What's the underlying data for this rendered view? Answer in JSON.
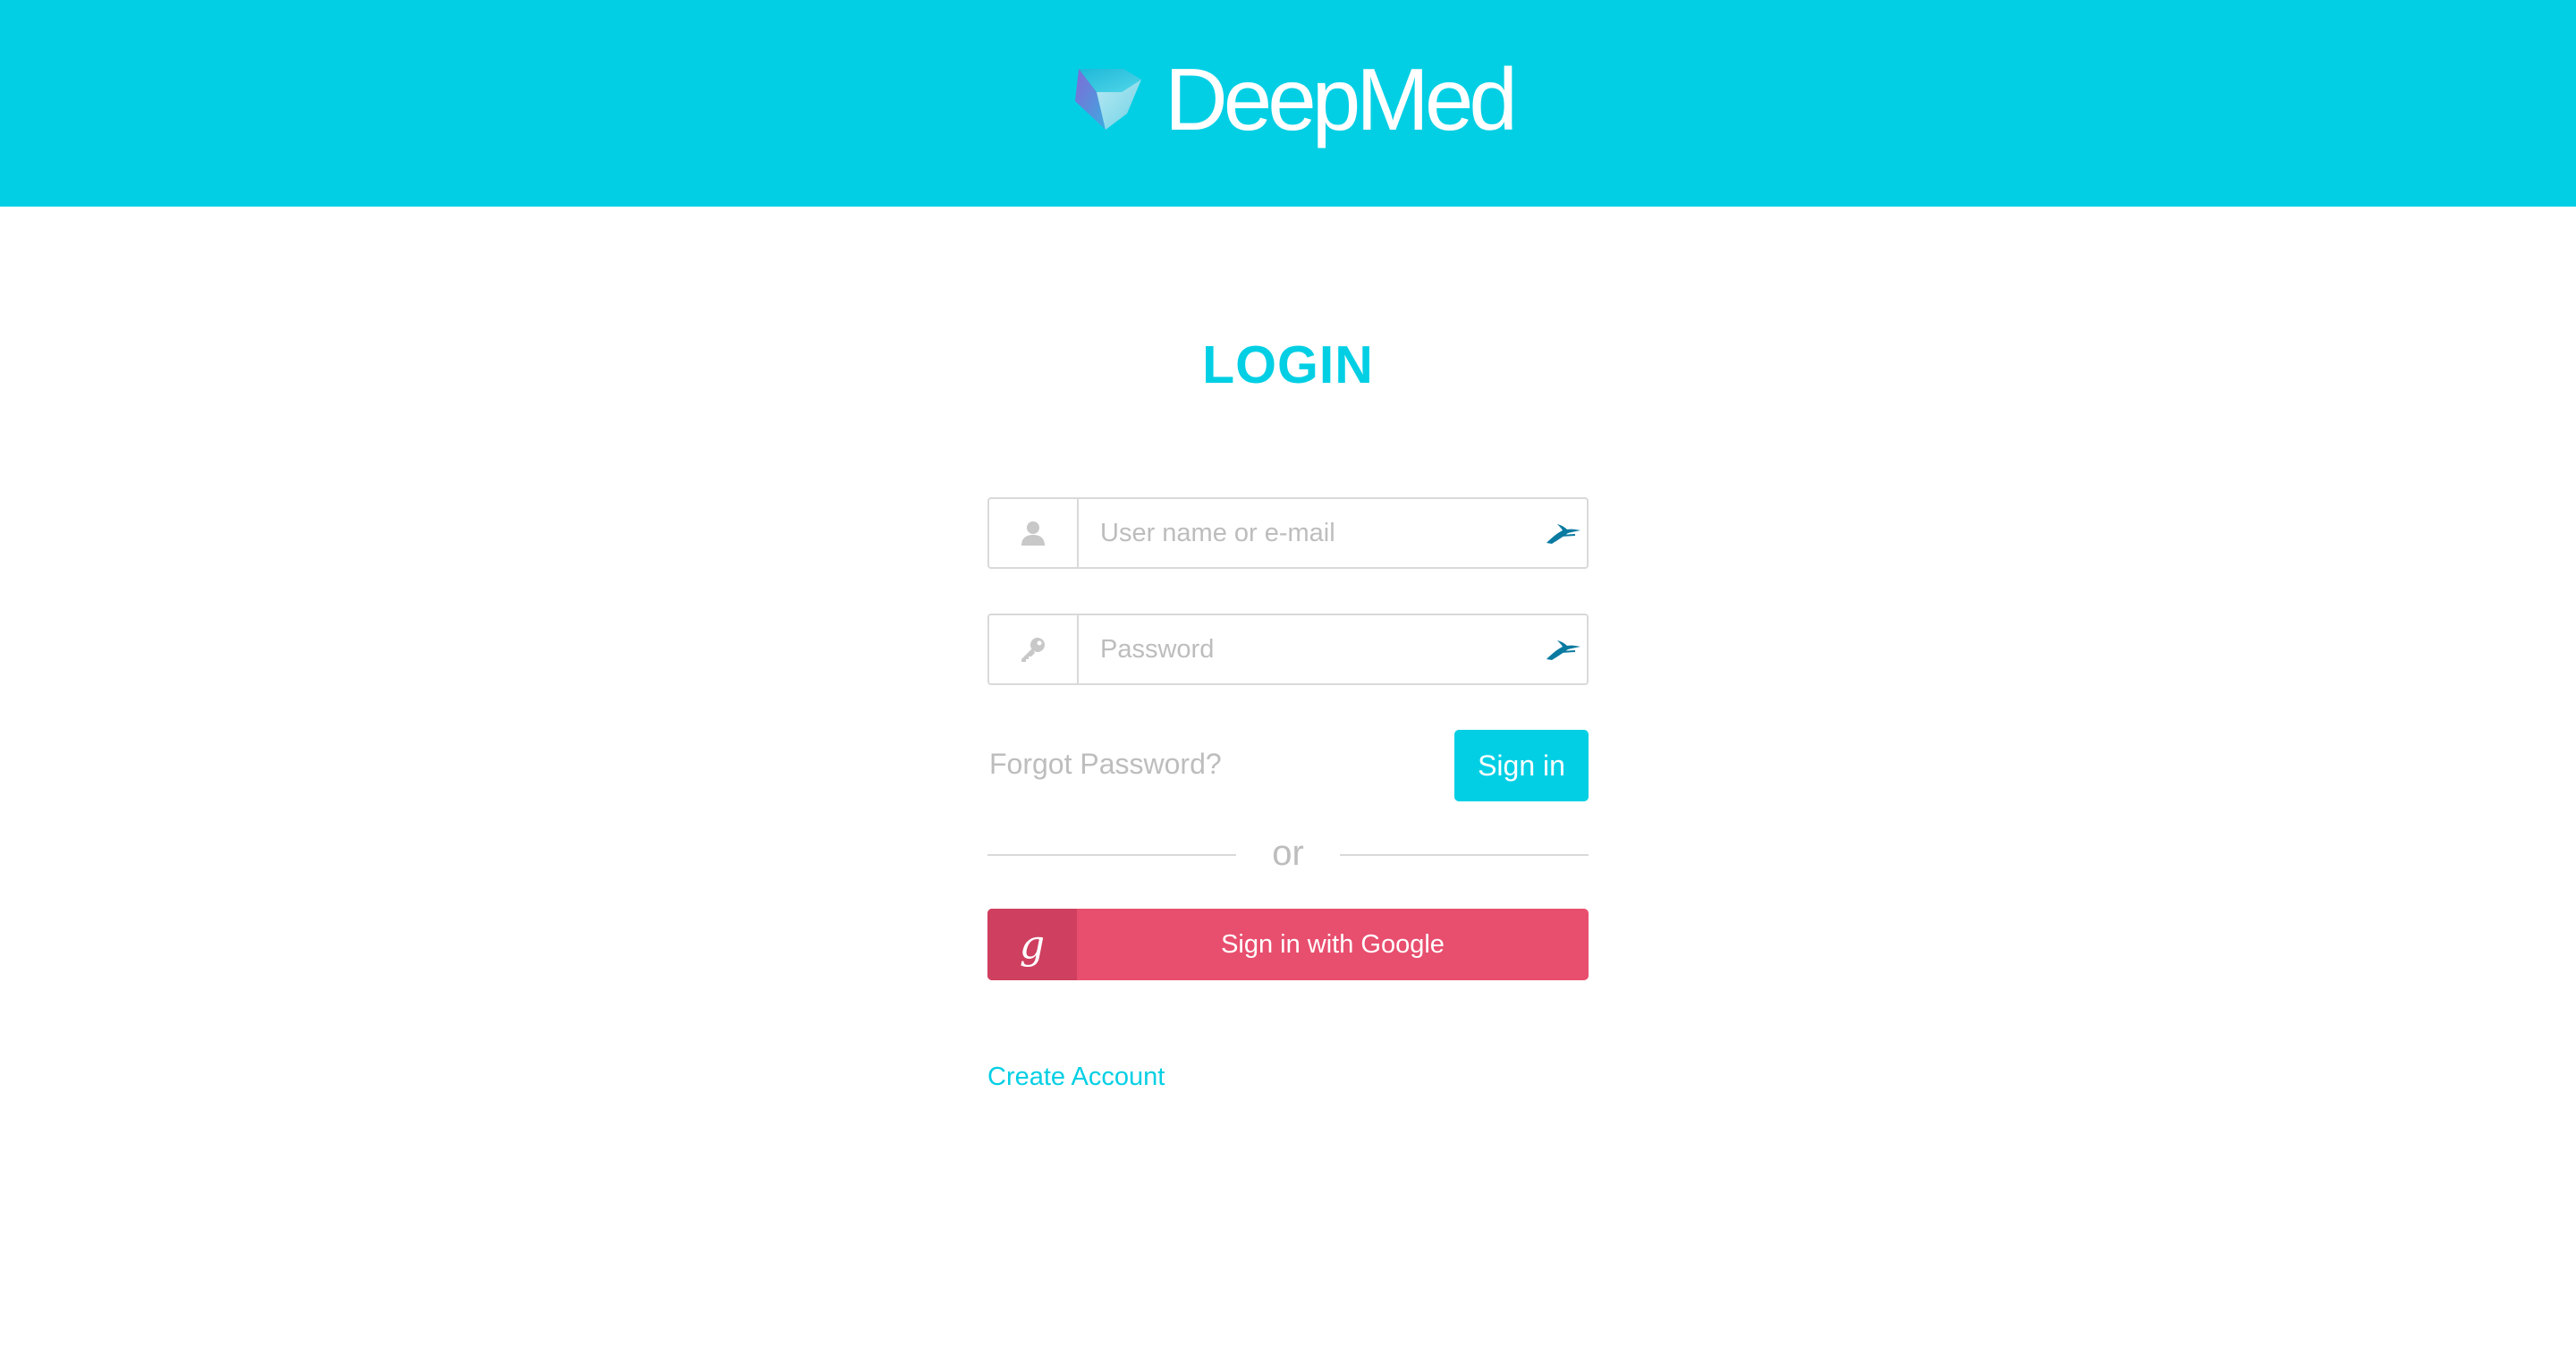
{
  "header": {
    "brand_name": "DeepMed",
    "background_color": "#03cfe4",
    "logo_icon": "gem-logo-icon"
  },
  "login": {
    "title": "LOGIN",
    "username": {
      "placeholder": "User name or e-mail",
      "value": "",
      "icon": "user-icon",
      "extension_icon": "password-manager-icon"
    },
    "password": {
      "placeholder": "Password",
      "value": "",
      "icon": "key-icon",
      "extension_icon": "password-manager-icon"
    },
    "forgot_password_label": "Forgot Password?",
    "signin_label": "Sign in",
    "divider_text": "or",
    "google": {
      "icon_letter": "g",
      "label": "Sign in with Google",
      "color": "#e84e6e"
    },
    "create_account_label": "Create Account"
  },
  "colors": {
    "accent": "#03cfe4",
    "google_red": "#e84e6e",
    "muted_text": "#bdbdbd"
  }
}
